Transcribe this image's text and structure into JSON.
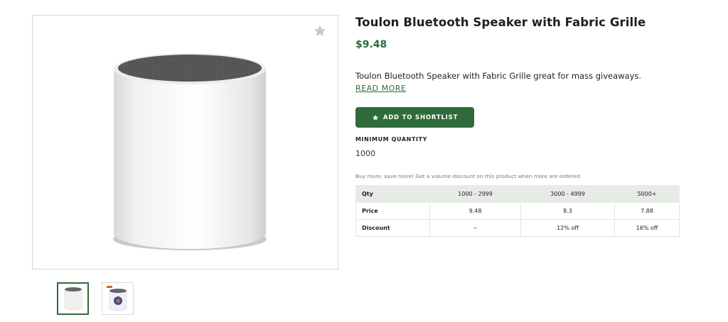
{
  "product": {
    "title": "Toulon Bluetooth Speaker with Fabric Grille",
    "price": "$9.48",
    "description": "Toulon Bluetooth Speaker with Fabric Grille great for mass giveaways.",
    "read_more": "READ MORE",
    "shortlist_label": "ADD TO SHORTLIST",
    "min_qty_label": "MINIMUM QUANTITY",
    "min_qty_value": "1000",
    "volume_note": "Buy more, save more! Get a volume discount on this product when more are ordered."
  },
  "pricing_table": {
    "header": [
      "Qty",
      "1000 - 2999",
      "3000 - 4999",
      "5000+"
    ],
    "rows": [
      [
        "Price",
        "9.48",
        "8.3",
        "7.88"
      ],
      [
        "Discount",
        "--",
        "12% off",
        "16% off"
      ]
    ]
  },
  "icons": {
    "favorite": "star-icon",
    "shortlist": "star-icon"
  },
  "colors": {
    "accent": "#2f6b3b",
    "table_header_bg": "#e7ebe6"
  }
}
